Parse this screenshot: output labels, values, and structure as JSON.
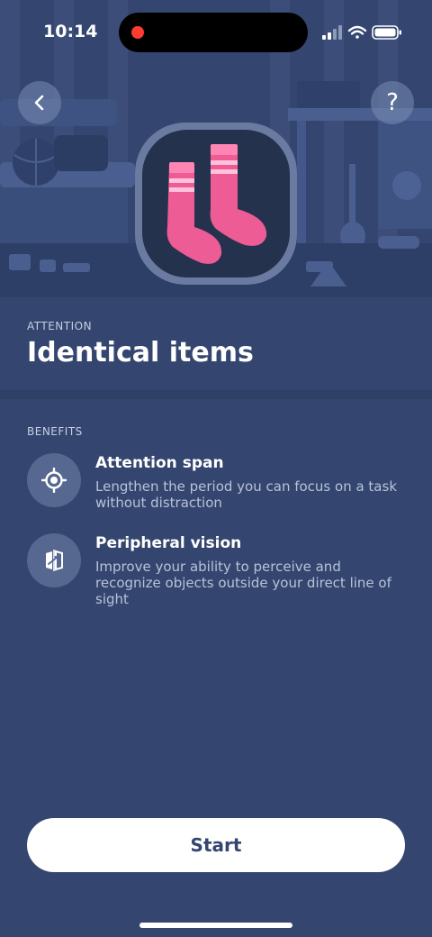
{
  "status_bar": {
    "time": "10:14"
  },
  "header": {
    "back_icon": "chevron-left-icon",
    "help_label": "?",
    "game_icon": "socks-icon"
  },
  "game": {
    "category": "ATTENTION",
    "title": "Identical items"
  },
  "benefits": {
    "section_label": "BENEFITS",
    "items": [
      {
        "icon": "target-icon",
        "name": "Attention span",
        "description": "Lengthen the period you can focus on a task without distraction"
      },
      {
        "icon": "peripheral-vision-icon",
        "name": "Peripheral vision",
        "description": "Improve your ability to perceive and recognize objects outside your direct line of sight"
      }
    ]
  },
  "actions": {
    "start_label": "Start"
  },
  "colors": {
    "background": "#34466f",
    "accent_pink": "#ee5c96",
    "button_bg": "#ffffff",
    "button_text": "#34466f"
  }
}
